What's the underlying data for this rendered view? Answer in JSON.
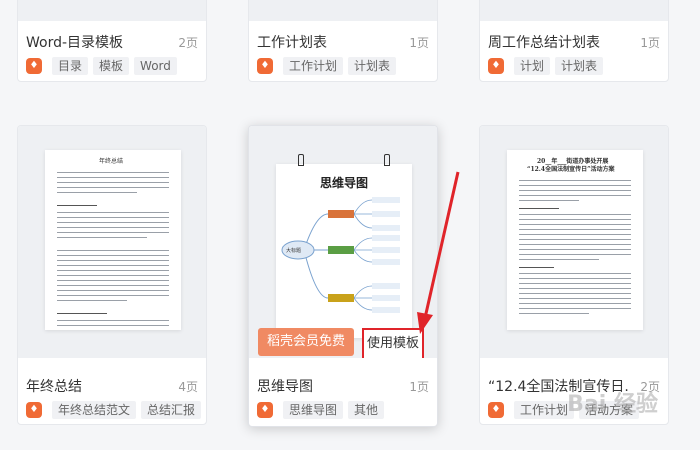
{
  "cards": [
    {
      "title": "Word-目录模板",
      "pages": "2页",
      "tags": [
        "目录",
        "模板",
        "Word"
      ]
    },
    {
      "title": "工作计划表",
      "pages": "1页",
      "tags": [
        "工作计划",
        "计划表"
      ]
    },
    {
      "title": "周工作总结计划表",
      "pages": "1页",
      "tags": [
        "计划",
        "计划表"
      ]
    },
    {
      "title": "年终总结",
      "pages": "4页",
      "tags": [
        "年终总结范文",
        "总结汇报"
      ],
      "doc_title": "年终总结"
    },
    {
      "title": "思维导图",
      "pages": "1页",
      "tags": [
        "思维导图",
        "其他"
      ],
      "doc_title": "思维导图"
    },
    {
      "title": "“12.4全国法制宣传日...",
      "pages": "2页",
      "tags": [
        "工作计划",
        "活动方案"
      ],
      "doc_title": "20__年___街道办事处开展",
      "doc_subtitle": "“12.4全国法制宣传日”活动方案"
    }
  ],
  "mindmap": {
    "center": "大标题",
    "branch": "小标题",
    "leaf": "输入文字"
  },
  "buttons": {
    "member": "稻壳会员免费",
    "use": "使用模板"
  },
  "tag_icon": "docer-icon",
  "watermark": "Bai 经验",
  "colors": {
    "accent": "#f06a35",
    "member_btn": "#f08a63",
    "highlight_border": "#e0242a",
    "arrow": "#e0242a"
  }
}
